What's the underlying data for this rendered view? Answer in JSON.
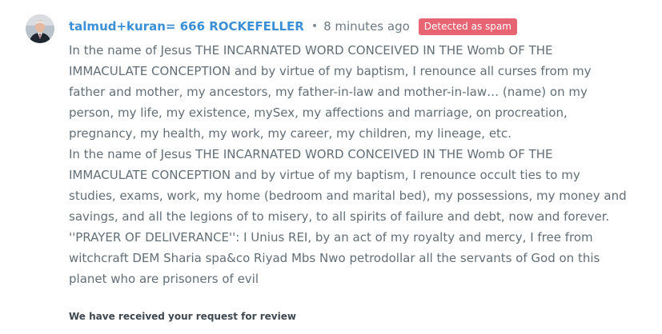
{
  "comment": {
    "author": "talmud+kuran= 666 ROCKEFELLER",
    "separator": "•",
    "timestamp": "8 minutes ago",
    "spam_badge": "Detected as spam",
    "paragraphs": [
      "In the name of Jesus THE INCARNATED WORD CONCEIVED IN THE Womb OF THE IMMACULATE CONCEPTION and by virtue of my baptism, I renounce all curses from my father and mother, my ancestors, my father-in-law and mother-in-law… (name) on my person, my life, my existence, mySex, my affections and marriage, on procreation, pregnancy, my health, my work, my career, my children, my lineage, etc.",
      "In the name of Jesus THE INCARNATED WORD CONCEIVED IN THE Womb OF THE IMMACULATE CONCEPTION and by virtue of my baptism, I renounce occult ties to my studies, exams, work, my home (bedroom and marital bed), my possessions, my money and savings, and all the legions of to misery, to all spirits of failure and debt, now and forever.",
      "''PRAYER OF DELIVERANCE'': I Unius REI, by an act of my royalty and mercy, I free from witchcraft DEM Sharia spa&co Riyad Mbs Nwo petrodollar all the servants of God on this planet who are prisoners of evil"
    ],
    "review_notice": "We have received your request for review",
    "colors": {
      "author": "#3b8fd6",
      "badge_bg": "#e76472",
      "body_text": "#626e76",
      "meta_text": "#6d7a82"
    }
  }
}
